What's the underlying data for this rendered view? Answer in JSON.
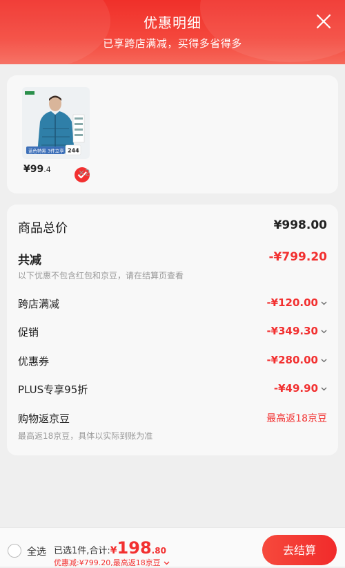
{
  "header": {
    "title": "优惠明细",
    "subtitle": "已享跨店满减，买得多省得多"
  },
  "product": {
    "image_badge_left": "蓝色特黑 3件立享",
    "image_badge_num": "244",
    "price_main": "¥99",
    "price_decimal": ".4",
    "quantity": "×2"
  },
  "detail": {
    "total_label": "商品总价",
    "total_value": "¥998.00",
    "reduce_label": "共减",
    "reduce_value": "-¥799.20",
    "reduce_note": "以下优惠不包含红包和京豆，请在结算页查看",
    "items": [
      {
        "label": "跨店满减",
        "value": "-¥120.00"
      },
      {
        "label": "促销",
        "value": "-¥349.30"
      },
      {
        "label": "优惠券",
        "value": "-¥280.00"
      },
      {
        "label": "PLUS专享95折",
        "value": "-¥49.90"
      }
    ],
    "beans_label": "购物返京豆",
    "beans_value": "最高返18京豆",
    "beans_note": "最高返18京豆，具体以实际到账为准"
  },
  "bottom": {
    "select_all": "全选",
    "summary_prefix": "已选1件,合计:",
    "total_currency": "¥",
    "total_int": "198",
    "total_dec": ".80",
    "discount_text": "优惠减:¥799.20,最高返18京豆",
    "checkout": "去结算"
  },
  "colors": {
    "accent": "#f23030",
    "header": "#f0302a"
  }
}
